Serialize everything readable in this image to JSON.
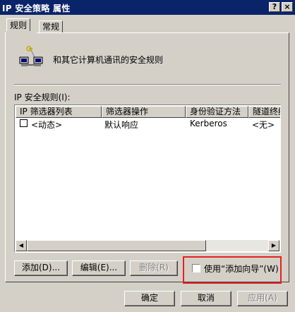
{
  "window": {
    "title": "IP 安全策略 属性",
    "help_label": "?",
    "close_label": "×"
  },
  "tabs": [
    {
      "label": "规则",
      "active": true
    },
    {
      "label": "常规",
      "active": false
    }
  ],
  "header": {
    "icon": "network-computers-icon",
    "description": "和其它计算机通讯的安全规则"
  },
  "rules_list": {
    "label": "IP 安全规则(I):",
    "columns": [
      "IP 筛选器列表",
      "筛选器操作",
      "身份验证方法",
      "隧道终结"
    ],
    "rows": [
      {
        "checked": false,
        "filter_list": "<动态>",
        "filter_action": "默认响应",
        "auth_method": "Kerberos",
        "tunnel": "<无>"
      }
    ]
  },
  "actions": {
    "add": "添加(D)...",
    "edit": "编辑(E)...",
    "remove": "删除(R)",
    "use_wizard": "使用“添加向导”(W)",
    "use_wizard_checked": false
  },
  "footer": {
    "ok": "确定",
    "cancel": "取消",
    "apply": "应用(A)"
  },
  "colors": {
    "title_bar": "#0a246a",
    "face": "#d4d0c8",
    "highlight_box": "#e8201e"
  }
}
